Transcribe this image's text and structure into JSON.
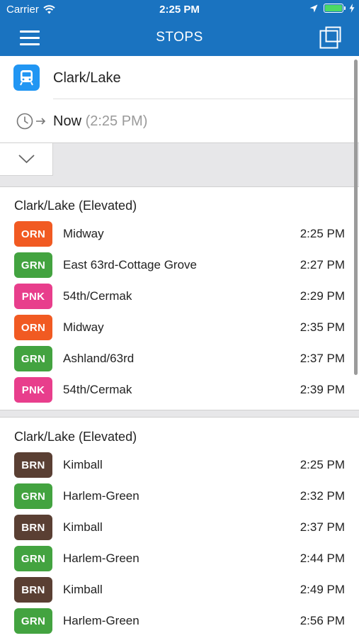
{
  "status_bar": {
    "carrier": "Carrier",
    "time": "2:25 PM"
  },
  "nav": {
    "title": "STOPS",
    "menu_icon": "hamburger-menu-icon",
    "right_icon": "copy-icon"
  },
  "stop": {
    "name": "Clark/Lake",
    "icon": "train-icon"
  },
  "when": {
    "label": "Now",
    "time": "(2:25 PM)",
    "icon": "clock-arrow-icon"
  },
  "colors": {
    "brand": "#1a73c0",
    "orange": "#f15a22",
    "green": "#43a340",
    "pink": "#e83e8c",
    "brown": "#5a3f33",
    "train_icon_bg": "#2196f3"
  },
  "sections": [
    {
      "title": "Clark/Lake (Elevated)",
      "departures": [
        {
          "route": "ORN",
          "color": "#f15a22",
          "destination": "Midway",
          "time": "2:25 PM"
        },
        {
          "route": "GRN",
          "color": "#43a340",
          "destination": "East 63rd-Cottage Grove",
          "time": "2:27 PM"
        },
        {
          "route": "PNK",
          "color": "#e83e8c",
          "destination": "54th/Cermak",
          "time": "2:29 PM"
        },
        {
          "route": "ORN",
          "color": "#f15a22",
          "destination": "Midway",
          "time": "2:35 PM"
        },
        {
          "route": "GRN",
          "color": "#43a340",
          "destination": "Ashland/63rd",
          "time": "2:37 PM"
        },
        {
          "route": "PNK",
          "color": "#e83e8c",
          "destination": "54th/Cermak",
          "time": "2:39 PM"
        }
      ]
    },
    {
      "title": "Clark/Lake (Elevated)",
      "departures": [
        {
          "route": "BRN",
          "color": "#5a3f33",
          "destination": "Kimball",
          "time": "2:25 PM"
        },
        {
          "route": "GRN",
          "color": "#43a340",
          "destination": "Harlem-Green",
          "time": "2:32 PM"
        },
        {
          "route": "BRN",
          "color": "#5a3f33",
          "destination": "Kimball",
          "time": "2:37 PM"
        },
        {
          "route": "GRN",
          "color": "#43a340",
          "destination": "Harlem-Green",
          "time": "2:44 PM"
        },
        {
          "route": "BRN",
          "color": "#5a3f33",
          "destination": "Kimball",
          "time": "2:49 PM"
        },
        {
          "route": "GRN",
          "color": "#43a340",
          "destination": "Harlem-Green",
          "time": "2:56 PM"
        }
      ]
    }
  ]
}
